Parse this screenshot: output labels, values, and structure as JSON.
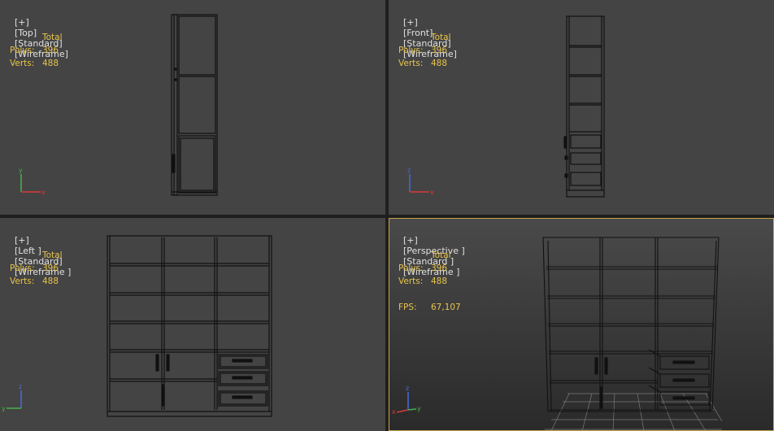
{
  "viewports": {
    "top": {
      "plus": "[+]",
      "view": "[Top]",
      "shading": "[Standard]",
      "mode": "[Wireframe]"
    },
    "front": {
      "plus": "[+]",
      "view": "[Front]",
      "shading": "[Standard]",
      "mode": "[Wireframe]"
    },
    "left": {
      "plus": "[+]",
      "view": "[Left ]",
      "shading": "[Standard]",
      "mode": "[Wireframe ]"
    },
    "perspective": {
      "plus": "[+]",
      "view": "[Perspective ]",
      "shading": "[Standard ]",
      "mode": "[Wireframe ]"
    }
  },
  "stats": {
    "total_label": "Total",
    "polys_label": "Polys:",
    "polys_value": "396",
    "verts_label": "Verts:",
    "verts_value": "488",
    "fps_label": "FPS:",
    "fps_value": "67,107"
  },
  "axes": {
    "x": "x",
    "y": "y",
    "z": "z"
  },
  "colors": {
    "viewport_bg": "#444444",
    "active_border": "#c8a24a",
    "stats_text": "#e8c44a",
    "label_text": "#e0e0e0",
    "axis_x": "#d83a3a",
    "axis_y": "#4ab04a",
    "axis_z": "#4a6ad8"
  }
}
